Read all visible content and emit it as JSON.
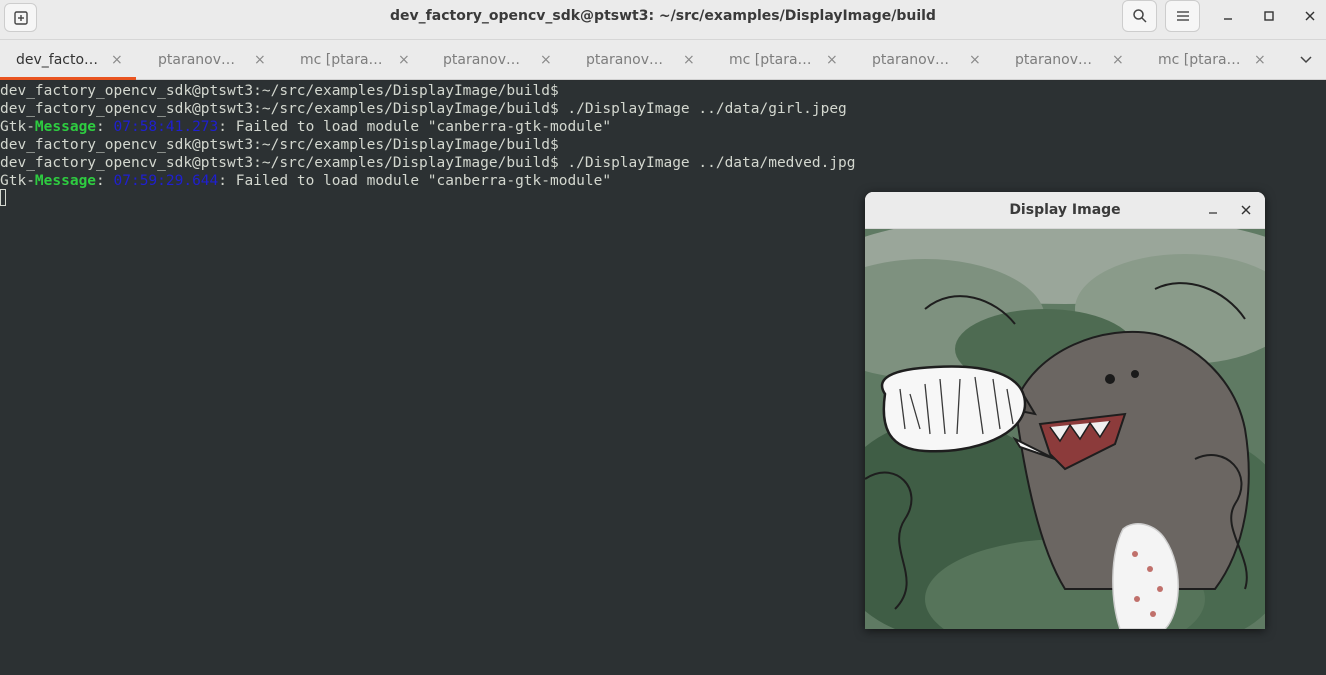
{
  "window": {
    "title": "dev_factory_opencv_sdk@ptswt3: ~/src/examples/DisplayImage/build"
  },
  "tabs": [
    {
      "label": "dev_facto…",
      "active": true
    },
    {
      "label": "ptaranov…",
      "active": false
    },
    {
      "label": "mc [ptara…",
      "active": false
    },
    {
      "label": "ptaranov…",
      "active": false
    },
    {
      "label": "ptaranov…",
      "active": false
    },
    {
      "label": "mc [ptara…",
      "active": false
    },
    {
      "label": "ptaranov…",
      "active": false
    },
    {
      "label": "ptaranov…",
      "active": false
    },
    {
      "label": "mc [ptara…",
      "active": false
    }
  ],
  "tab_close_glyph": "×",
  "terminal": {
    "prompt": "dev_factory_opencv_sdk@ptswt3:~/src/examples/DisplayImage/build$",
    "lines": [
      {
        "prompt": "dev_factory_opencv_sdk@ptswt3:~/src/examples/DisplayImage/build$",
        "cmd": ""
      },
      {
        "prompt": "dev_factory_opencv_sdk@ptswt3:~/src/examples/DisplayImage/build$",
        "cmd": " ./DisplayImage ../data/girl.jpeg"
      },
      {
        "gtk": "Gtk-",
        "msg": "Message",
        "colon": ": ",
        "ts": "07:58:41.273",
        "rest": ": Failed to load module \"canberra-gtk-module\""
      },
      {
        "prompt": "dev_factory_opencv_sdk@ptswt3:~/src/examples/DisplayImage/build$",
        "cmd": ""
      },
      {
        "prompt": "dev_factory_opencv_sdk@ptswt3:~/src/examples/DisplayImage/build$",
        "cmd": " ./DisplayImage ../data/medved.jpg"
      },
      {
        "gtk": "Gtk-",
        "msg": "Message",
        "colon": ": ",
        "ts": "07:59:29.644",
        "rest": ": Failed to load module \"canberra-gtk-module\""
      }
    ]
  },
  "dialog": {
    "title": "Display Image",
    "image_description": "drawing of a bear in bushes with speech bubble and a white bag"
  },
  "colors": {
    "accent": "#e95420",
    "terminal_bg": "#2c3133",
    "message_green": "#2ecc40",
    "timestamp_blue": "#1f1fd0"
  }
}
